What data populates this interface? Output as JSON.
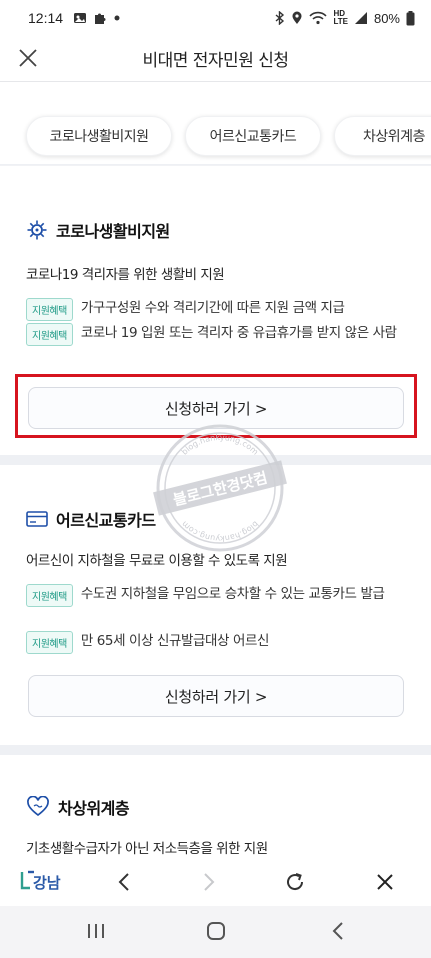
{
  "status": {
    "time": "12:14",
    "battery": "80%",
    "network_label": "HD",
    "network_sub": "LTE"
  },
  "header": {
    "title": "비대면 전자민원 신청"
  },
  "chips": [
    "코로나생활비지원",
    "어르신교통카드",
    "차상위계층"
  ],
  "sections": [
    {
      "icon": "virus-icon",
      "title": "코로나생활비지원",
      "desc": "코로나19 격리자를 위한 생활비 지원",
      "benefits": [
        {
          "badge": "지원혜택",
          "text": "가구구성원 수와 격리기간에 따른 지원 금액 지급"
        },
        {
          "badge": "지원혜택",
          "text": "코로나 19 입원 또는 격리자 중 유급휴가를 받지 않은 사람"
        }
      ],
      "button": "신청하러 가기 >"
    },
    {
      "icon": "card-icon",
      "title": "어르신교통카드",
      "desc": "어르신이 지하철을 무료로 이용할 수 있도록 지원",
      "benefits": [
        {
          "badge": "지원혜택",
          "text": "수도권 지하철을 무임으로 승차할 수 있는 교통카드 발급"
        },
        {
          "badge": "지원혜택",
          "text": "만 65세 이상 신규발급대상 어르신"
        }
      ],
      "button": "신청하러 가기 >"
    },
    {
      "icon": "heart-hand-icon",
      "title": "차상위계층",
      "desc": "기초생활수급자가 아닌 저소득층을 위한 지원"
    }
  ],
  "watermark": {
    "main": "블로그한경닷컴",
    "arc_top": "blog.hankyung.com",
    "arc_bottom": "blog.hankyung.com"
  },
  "brand": {
    "logo_text": "강남"
  },
  "colors": {
    "accent": "#1e4fa8",
    "badge": "#1e9a86",
    "highlight": "#d6141f"
  }
}
